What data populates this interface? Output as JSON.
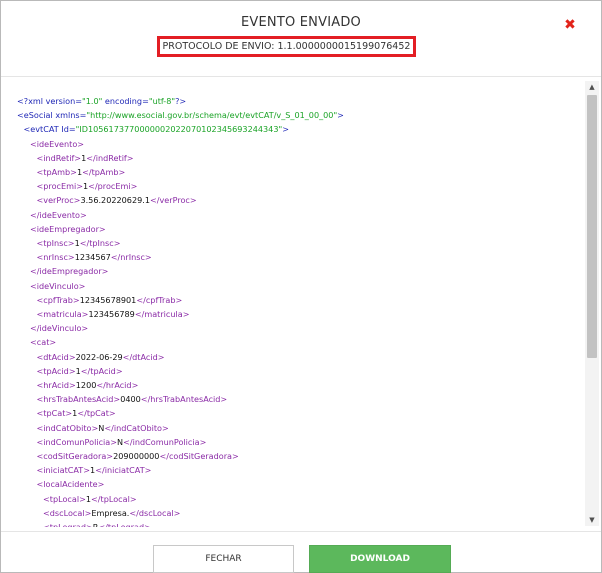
{
  "modal": {
    "title": "EVENTO ENVIADO",
    "protocol": "PROTOCOLO DE ENVIO: 1.1.0000000015199076452",
    "close_glyph": "✖"
  },
  "xml_lines": [
    {
      "indent": 0,
      "parts": [
        {
          "c": "blue",
          "t": "<?xml version="
        },
        {
          "c": "grn",
          "t": "\"1.0\""
        },
        {
          "c": "blue",
          "t": " encoding="
        },
        {
          "c": "grn",
          "t": "\"utf-8\""
        },
        {
          "c": "blue",
          "t": "?>"
        }
      ]
    },
    {
      "indent": 0,
      "parts": [
        {
          "c": "blue",
          "t": "<eSocial xmlns="
        },
        {
          "c": "grn",
          "t": "\"http://www.esocial.gov.br/schema/evt/evtCAT/v_S_01_00_00\""
        },
        {
          "c": "blue",
          "t": ">"
        }
      ]
    },
    {
      "indent": 1,
      "parts": [
        {
          "c": "blue",
          "t": "<evtCAT Id="
        },
        {
          "c": "grn",
          "t": "\"ID1056173770000002022070102345693244343\""
        },
        {
          "c": "blue",
          "t": ">"
        }
      ]
    },
    {
      "indent": 2,
      "parts": [
        {
          "c": "tag",
          "t": "<ideEvento>"
        }
      ]
    },
    {
      "indent": 3,
      "parts": [
        {
          "c": "tag",
          "t": "<indRetif>"
        },
        {
          "c": "txt",
          "t": "1"
        },
        {
          "c": "tag",
          "t": "</indRetif>"
        }
      ]
    },
    {
      "indent": 3,
      "parts": [
        {
          "c": "tag",
          "t": "<tpAmb>"
        },
        {
          "c": "txt",
          "t": "1"
        },
        {
          "c": "tag",
          "t": "</tpAmb>"
        }
      ]
    },
    {
      "indent": 3,
      "parts": [
        {
          "c": "tag",
          "t": "<procEmi>"
        },
        {
          "c": "txt",
          "t": "1"
        },
        {
          "c": "tag",
          "t": "</procEmi>"
        }
      ]
    },
    {
      "indent": 3,
      "parts": [
        {
          "c": "tag",
          "t": "<verProc>"
        },
        {
          "c": "txt",
          "t": "3.56.20220629.1"
        },
        {
          "c": "tag",
          "t": "</verProc>"
        }
      ]
    },
    {
      "indent": 2,
      "parts": [
        {
          "c": "tag",
          "t": "</ideEvento>"
        }
      ]
    },
    {
      "indent": 2,
      "parts": [
        {
          "c": "tag",
          "t": "<ideEmpregador>"
        }
      ]
    },
    {
      "indent": 3,
      "parts": [
        {
          "c": "tag",
          "t": "<tpInsc>"
        },
        {
          "c": "txt",
          "t": "1"
        },
        {
          "c": "tag",
          "t": "</tpInsc>"
        }
      ]
    },
    {
      "indent": 3,
      "parts": [
        {
          "c": "tag",
          "t": "<nrInsc>"
        },
        {
          "c": "txt",
          "t": "1234567"
        },
        {
          "c": "tag",
          "t": "</nrInsc>"
        }
      ]
    },
    {
      "indent": 2,
      "parts": [
        {
          "c": "tag",
          "t": "</ideEmpregador>"
        }
      ]
    },
    {
      "indent": 2,
      "parts": [
        {
          "c": "tag",
          "t": "<ideVinculo>"
        }
      ]
    },
    {
      "indent": 3,
      "parts": [
        {
          "c": "tag",
          "t": "<cpfTrab>"
        },
        {
          "c": "txt",
          "t": "12345678901"
        },
        {
          "c": "tag",
          "t": "</cpfTrab>"
        }
      ]
    },
    {
      "indent": 3,
      "parts": [
        {
          "c": "tag",
          "t": "<matricula>"
        },
        {
          "c": "txt",
          "t": "123456789"
        },
        {
          "c": "tag",
          "t": "</matricula>"
        }
      ]
    },
    {
      "indent": 2,
      "parts": [
        {
          "c": "tag",
          "t": "</ideVinculo>"
        }
      ]
    },
    {
      "indent": 2,
      "parts": [
        {
          "c": "tag",
          "t": "<cat>"
        }
      ]
    },
    {
      "indent": 3,
      "parts": [
        {
          "c": "tag",
          "t": "<dtAcid>"
        },
        {
          "c": "txt",
          "t": "2022-06-29"
        },
        {
          "c": "tag",
          "t": "</dtAcid>"
        }
      ]
    },
    {
      "indent": 3,
      "parts": [
        {
          "c": "tag",
          "t": "<tpAcid>"
        },
        {
          "c": "txt",
          "t": "1"
        },
        {
          "c": "tag",
          "t": "</tpAcid>"
        }
      ]
    },
    {
      "indent": 3,
      "parts": [
        {
          "c": "tag",
          "t": "<hrAcid>"
        },
        {
          "c": "txt",
          "t": "1200"
        },
        {
          "c": "tag",
          "t": "</hrAcid>"
        }
      ]
    },
    {
      "indent": 3,
      "parts": [
        {
          "c": "tag",
          "t": "<hrsTrabAntesAcid>"
        },
        {
          "c": "txt",
          "t": "0400"
        },
        {
          "c": "tag",
          "t": "</hrsTrabAntesAcid>"
        }
      ]
    },
    {
      "indent": 3,
      "parts": [
        {
          "c": "tag",
          "t": "<tpCat>"
        },
        {
          "c": "txt",
          "t": "1"
        },
        {
          "c": "tag",
          "t": "</tpCat>"
        }
      ]
    },
    {
      "indent": 3,
      "parts": [
        {
          "c": "tag",
          "t": "<indCatObito>"
        },
        {
          "c": "txt",
          "t": "N"
        },
        {
          "c": "tag",
          "t": "</indCatObito>"
        }
      ]
    },
    {
      "indent": 3,
      "parts": [
        {
          "c": "tag",
          "t": "<indComunPolicia>"
        },
        {
          "c": "txt",
          "t": "N"
        },
        {
          "c": "tag",
          "t": "</indComunPolicia>"
        }
      ]
    },
    {
      "indent": 3,
      "parts": [
        {
          "c": "tag",
          "t": "<codSitGeradora>"
        },
        {
          "c": "txt",
          "t": "209000000"
        },
        {
          "c": "tag",
          "t": "</codSitGeradora>"
        }
      ]
    },
    {
      "indent": 3,
      "parts": [
        {
          "c": "tag",
          "t": "<iniciatCAT>"
        },
        {
          "c": "txt",
          "t": "1"
        },
        {
          "c": "tag",
          "t": "</iniciatCAT>"
        }
      ]
    },
    {
      "indent": 3,
      "parts": [
        {
          "c": "tag",
          "t": "<localAcidente>"
        }
      ]
    },
    {
      "indent": 4,
      "parts": [
        {
          "c": "tag",
          "t": "<tpLocal>"
        },
        {
          "c": "txt",
          "t": "1"
        },
        {
          "c": "tag",
          "t": "</tpLocal>"
        }
      ]
    },
    {
      "indent": 4,
      "parts": [
        {
          "c": "tag",
          "t": "<dscLocal>"
        },
        {
          "c": "txt",
          "t": "Empresa."
        },
        {
          "c": "tag",
          "t": "</dscLocal>"
        }
      ]
    },
    {
      "indent": 4,
      "parts": [
        {
          "c": "tag",
          "t": "<tpLograd>"
        },
        {
          "c": "txt",
          "t": "R"
        },
        {
          "c": "tag",
          "t": "</tpLograd>"
        }
      ]
    }
  ],
  "scrollbar": {
    "up_glyph": "▲",
    "down_glyph": "▼"
  },
  "buttons": {
    "fechar": "FECHAR",
    "download": "DOWNLOAD"
  }
}
